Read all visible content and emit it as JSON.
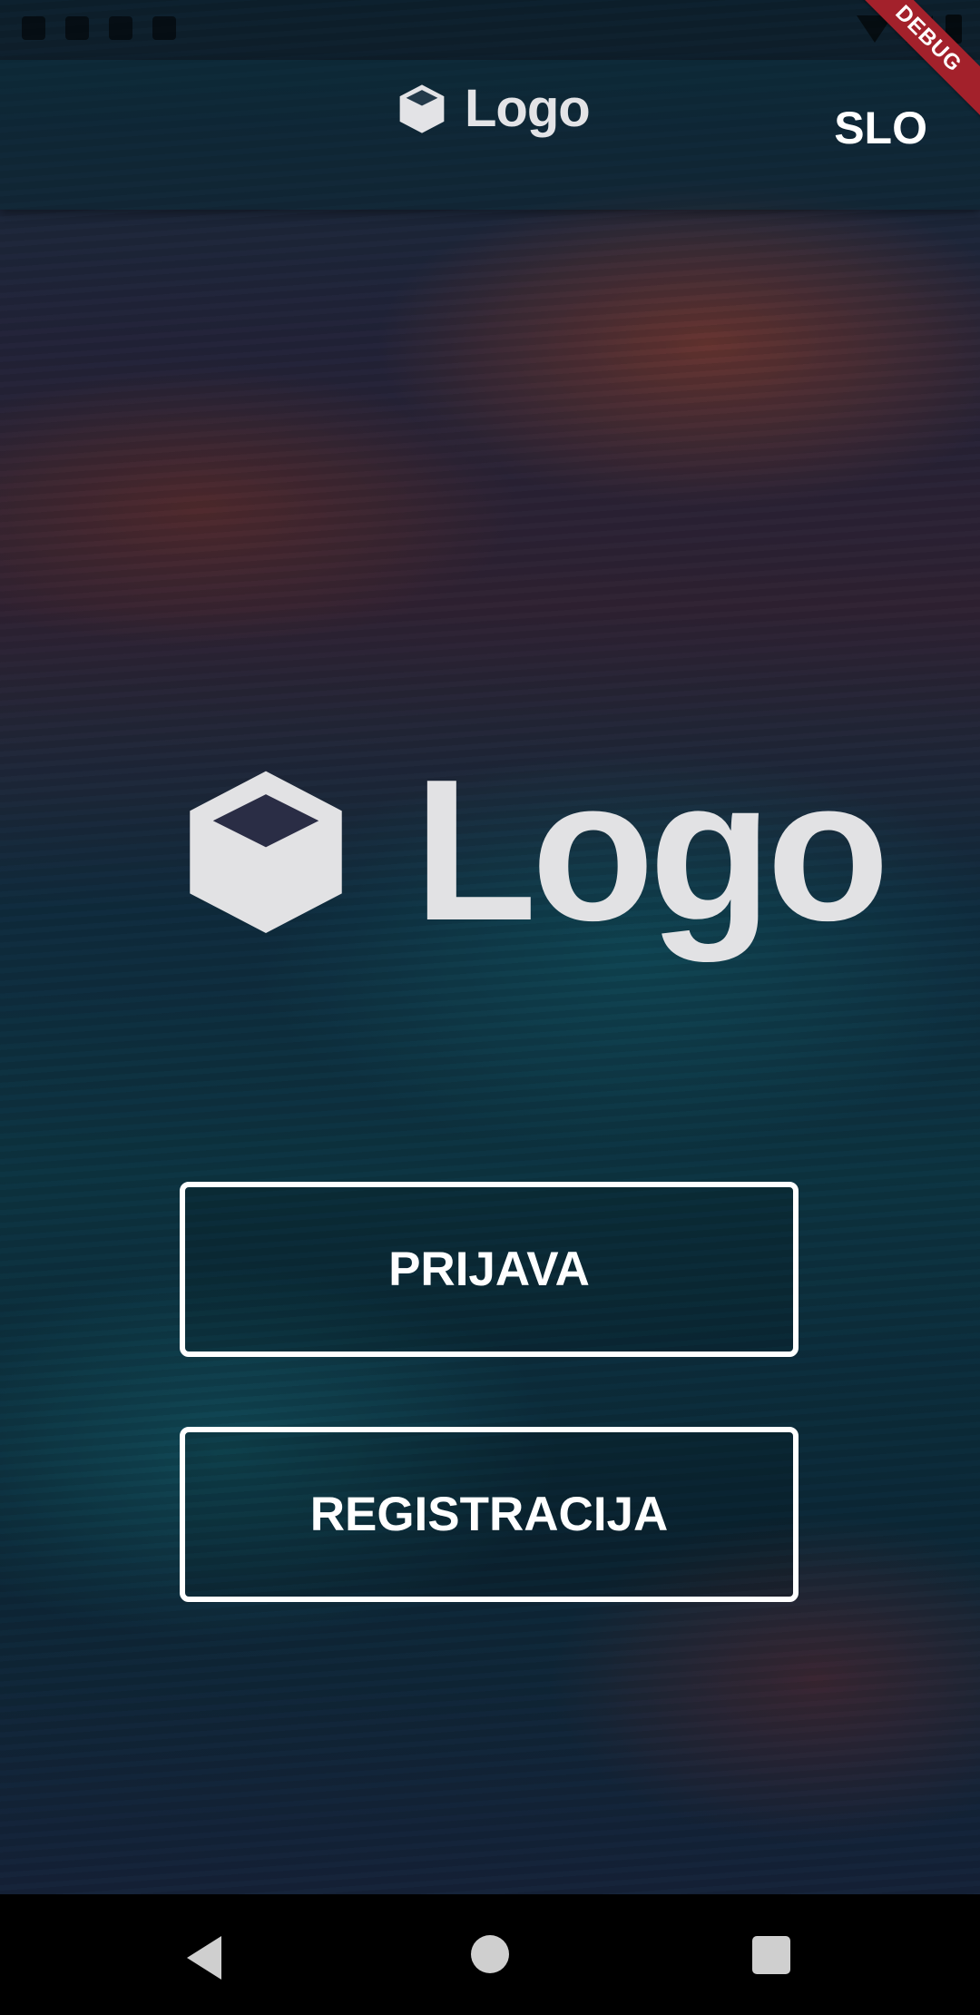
{
  "app_bar": {
    "logo_text": "Logo",
    "language_label": "SLO"
  },
  "debug_banner": {
    "label": "DEBUG"
  },
  "hero": {
    "logo_text": "Logo"
  },
  "actions": {
    "login_label": "PRIJAVA",
    "register_label": "REGISTRACIJA"
  },
  "icons": {
    "logo": "cube-icon",
    "status": [
      "wifi-icon",
      "signal-icon",
      "battery-icon"
    ],
    "navigation": [
      "back-icon",
      "home-icon",
      "recent-apps-icon"
    ]
  },
  "colors": {
    "button_border": "#ffffff",
    "debug_banner": "#a3212b",
    "logo": "#e2e2e4"
  }
}
